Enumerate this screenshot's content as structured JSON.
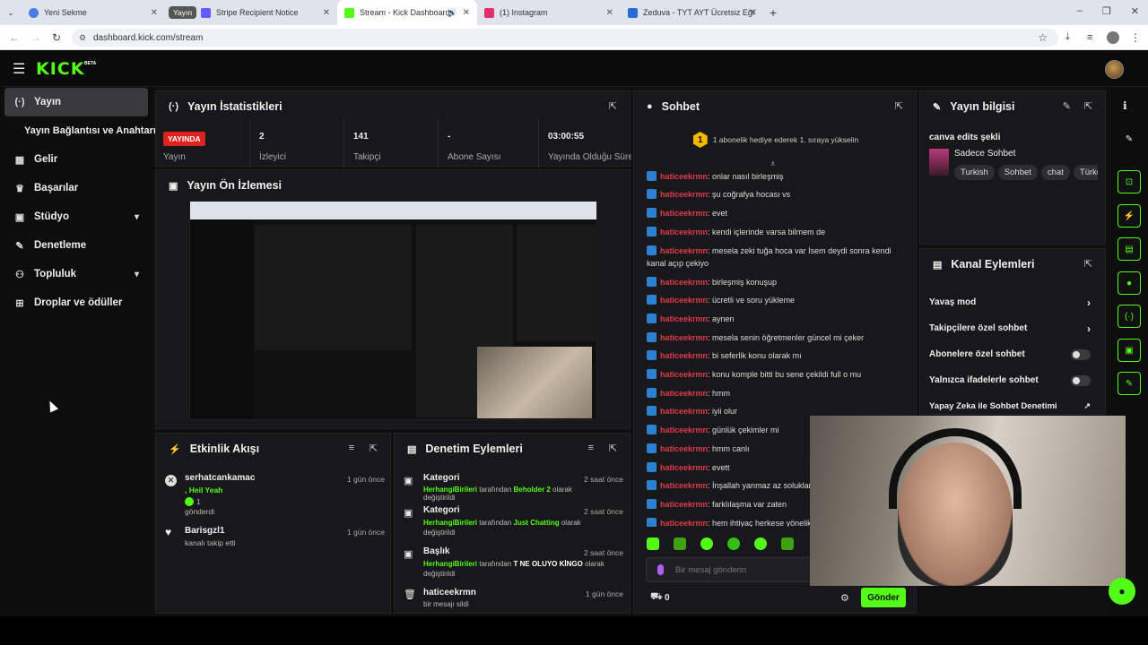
{
  "browser": {
    "tabs": [
      {
        "title": "Yeni Sekme",
        "color": "#4a7be8"
      },
      {
        "title": "Yayın",
        "color": "#444"
      },
      {
        "title": "Stripe Recipient Notice",
        "color": "#635bff"
      },
      {
        "title": "Stream - Kick Dashboard",
        "color": "#53fc18"
      },
      {
        "title": "(1) Instagram",
        "color": "#e1306c"
      },
      {
        "title": "Zeduva - TYT AYT Ücretsiz Eği",
        "color": "#2a6bd8"
      }
    ],
    "url": "dashboard.kick.com/stream"
  },
  "brand": {
    "logo": "KICK",
    "beta": "BETA"
  },
  "sidebar": {
    "items": [
      {
        "label": "Yayın",
        "icon": "broadcast-icon"
      },
      {
        "label": "Yayın Bağlantısı ve Anahtarı"
      },
      {
        "label": "Gelir",
        "icon": "revenue-icon"
      },
      {
        "label": "Başarılar",
        "icon": "trophy-icon"
      },
      {
        "label": "Stüdyo",
        "icon": "studio-icon"
      },
      {
        "label": "Denetleme",
        "icon": "wrench-icon"
      },
      {
        "label": "Topluluk",
        "icon": "community-icon"
      },
      {
        "label": "Droplar ve ödüller",
        "icon": "drops-icon"
      }
    ]
  },
  "stats": {
    "title": "Yayın İstatistikleri",
    "live": "YAYINDA",
    "items": [
      {
        "label": "Yayın",
        "value": ""
      },
      {
        "label": "İzleyici",
        "value": "2"
      },
      {
        "label": "Takipçi",
        "value": "141"
      },
      {
        "label": "Abone Sayısı",
        "value": "-"
      },
      {
        "label": "Yayında Olduğu Süre",
        "value": "03:00:55"
      }
    ]
  },
  "preview": {
    "title": "Yayın Ön İzlemesi"
  },
  "activity": {
    "title": "Etkinlik Akışı",
    "items": [
      {
        "user": "serhatcankamac",
        "msg": ", Heil Yeah",
        "count": "1",
        "sub": "gönderdi",
        "time": "1 gün önce"
      },
      {
        "user": "Barisgzl1",
        "sub": "kanalı takip etti",
        "time": "1 gün önce"
      }
    ]
  },
  "moderation": {
    "title": "Denetim Eylemleri",
    "items": [
      {
        "title": "Kategori",
        "actor": "HerhangiBirileri",
        "mid": "tarafından",
        "target": "Beholder 2",
        "end": "olarak değiştirildi",
        "time": "2 saat önce"
      },
      {
        "title": "Kategori",
        "actor": "HerhangiBirileri",
        "mid": "tarafından",
        "target": "Just Chatting",
        "end": "olarak değiştirildi",
        "time": "2 saat önce"
      },
      {
        "title": "Başlık",
        "actor": "HerhangiBirileri",
        "mid": "tarafından",
        "target": "T NE OLUYO KİNGO",
        "end": "olarak değiştirildi",
        "time": "2 saat önce"
      },
      {
        "title": "haticeekrmn",
        "end": "bir mesajı sildi",
        "time": "1 gün önce"
      }
    ]
  },
  "chat": {
    "title": "Sohbet",
    "banner": "1 abonelik hediye ederek 1. sıraya yükselin",
    "banner_num": "1",
    "messages": [
      {
        "user": "haticeekrmn",
        "text": ": onlar nasıl birleşmiş"
      },
      {
        "user": "haticeekrmn",
        "text": ": şu coğrafya hocası vs"
      },
      {
        "user": "haticeekrmn",
        "text": ": evet"
      },
      {
        "user": "haticeekrmn",
        "text": ": kendi içlerinde varsa bilmem de"
      },
      {
        "user": "haticeekrmn",
        "text": ": mesela zeki tuğa hoca var İsem deydi sonra kendi kanal açıp çekiyo"
      },
      {
        "user": "haticeekrmn",
        "text": ": birleşmiş konuşup"
      },
      {
        "user": "haticeekrmn",
        "text": ": ücretli ve soru yükleme"
      },
      {
        "user": "haticeekrmn",
        "text": ": aynen"
      },
      {
        "user": "haticeekrmn",
        "text": ": mesela senin öğretmenler güncel mi çeker"
      },
      {
        "user": "haticeekrmn",
        "text": ": bi seferlik konu olarak mı"
      },
      {
        "user": "haticeekrmn",
        "text": ": konu komple bitti bu sene çekildi full o mu"
      },
      {
        "user": "haticeekrmn",
        "text": ": hmm"
      },
      {
        "user": "haticeekrmn",
        "text": ": iyii olur"
      },
      {
        "user": "haticeekrmn",
        "text": ": günlük çekimler mi"
      },
      {
        "user": "haticeekrmn",
        "text": ": hmm canlı"
      },
      {
        "user": "haticeekrmn",
        "text": ": evett"
      },
      {
        "user": "haticeekrmn",
        "text": ": İnşallah yanmaz az soluklar"
      },
      {
        "user": "haticeekrmn",
        "text": ": farklılaşma var zaten"
      },
      {
        "user": "haticeekrmn",
        "text": ": hem ihtiyaç herkese yönelik"
      }
    ],
    "placeholder": "Bir mesaj gönderin",
    "points": "0",
    "send": "Gönder"
  },
  "info": {
    "title": "Yayın bilgisi",
    "stream_title": "canva edits şekli",
    "category": "Sadece Sohbet",
    "tags": [
      "Turkish",
      "Sohbet",
      "chat",
      "Türkç"
    ]
  },
  "channel_actions": {
    "title": "Kanal Eylemleri",
    "items": [
      {
        "label": "Yavaş mod",
        "kind": "chevron"
      },
      {
        "label": "Takipçilere özel sohbet",
        "kind": "chevron"
      },
      {
        "label": "Abonelere özel sohbet",
        "kind": "toggle"
      },
      {
        "label": "Yalnızca ifadelerle sohbet",
        "kind": "toggle"
      },
      {
        "label": "Yapay Zeka ile Sohbet Denetimi",
        "kind": "link"
      }
    ]
  },
  "colors": {
    "accent": "#53fc18",
    "live": "#dd2222",
    "username": "#e03a4e"
  }
}
